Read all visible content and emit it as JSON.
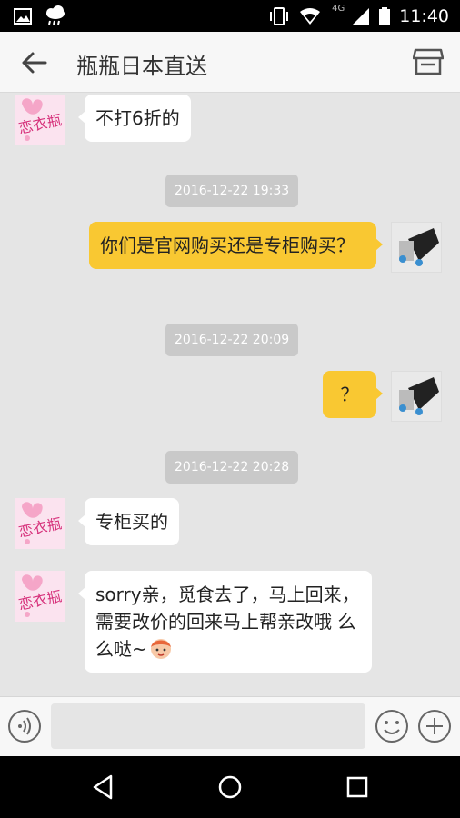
{
  "status_bar": {
    "time": "11:40",
    "network": "4G"
  },
  "header": {
    "title": "瓶瓶日本直送"
  },
  "messages": [
    {
      "side": "left",
      "text": "不打6折的"
    },
    {
      "type": "timestamp",
      "text": "2016-12-22 19:33"
    },
    {
      "side": "right",
      "text": "你们是官网购买还是专柜购买？"
    },
    {
      "type": "timestamp",
      "text": "2016-12-22 20:09"
    },
    {
      "side": "right",
      "text": "？"
    },
    {
      "type": "timestamp",
      "text": "2016-12-22 20:28"
    },
    {
      "side": "left",
      "text": "专柜买的"
    },
    {
      "side": "left",
      "text": "sorry亲，觅食去了，马上回来，需要改价的回来马上帮亲改哦 么么哒~",
      "emoji": "girl-face-emoji"
    }
  ],
  "input": {
    "value": ""
  },
  "icons": {
    "back": "arrow-left-icon",
    "shop": "storefront-icon",
    "voice": "voice-icon",
    "emoji": "smiley-icon",
    "plus": "plus-icon"
  },
  "colors": {
    "outgoing_bubble": "#f9c832",
    "incoming_bubble": "#ffffff",
    "chat_background": "#e5e5e5"
  }
}
